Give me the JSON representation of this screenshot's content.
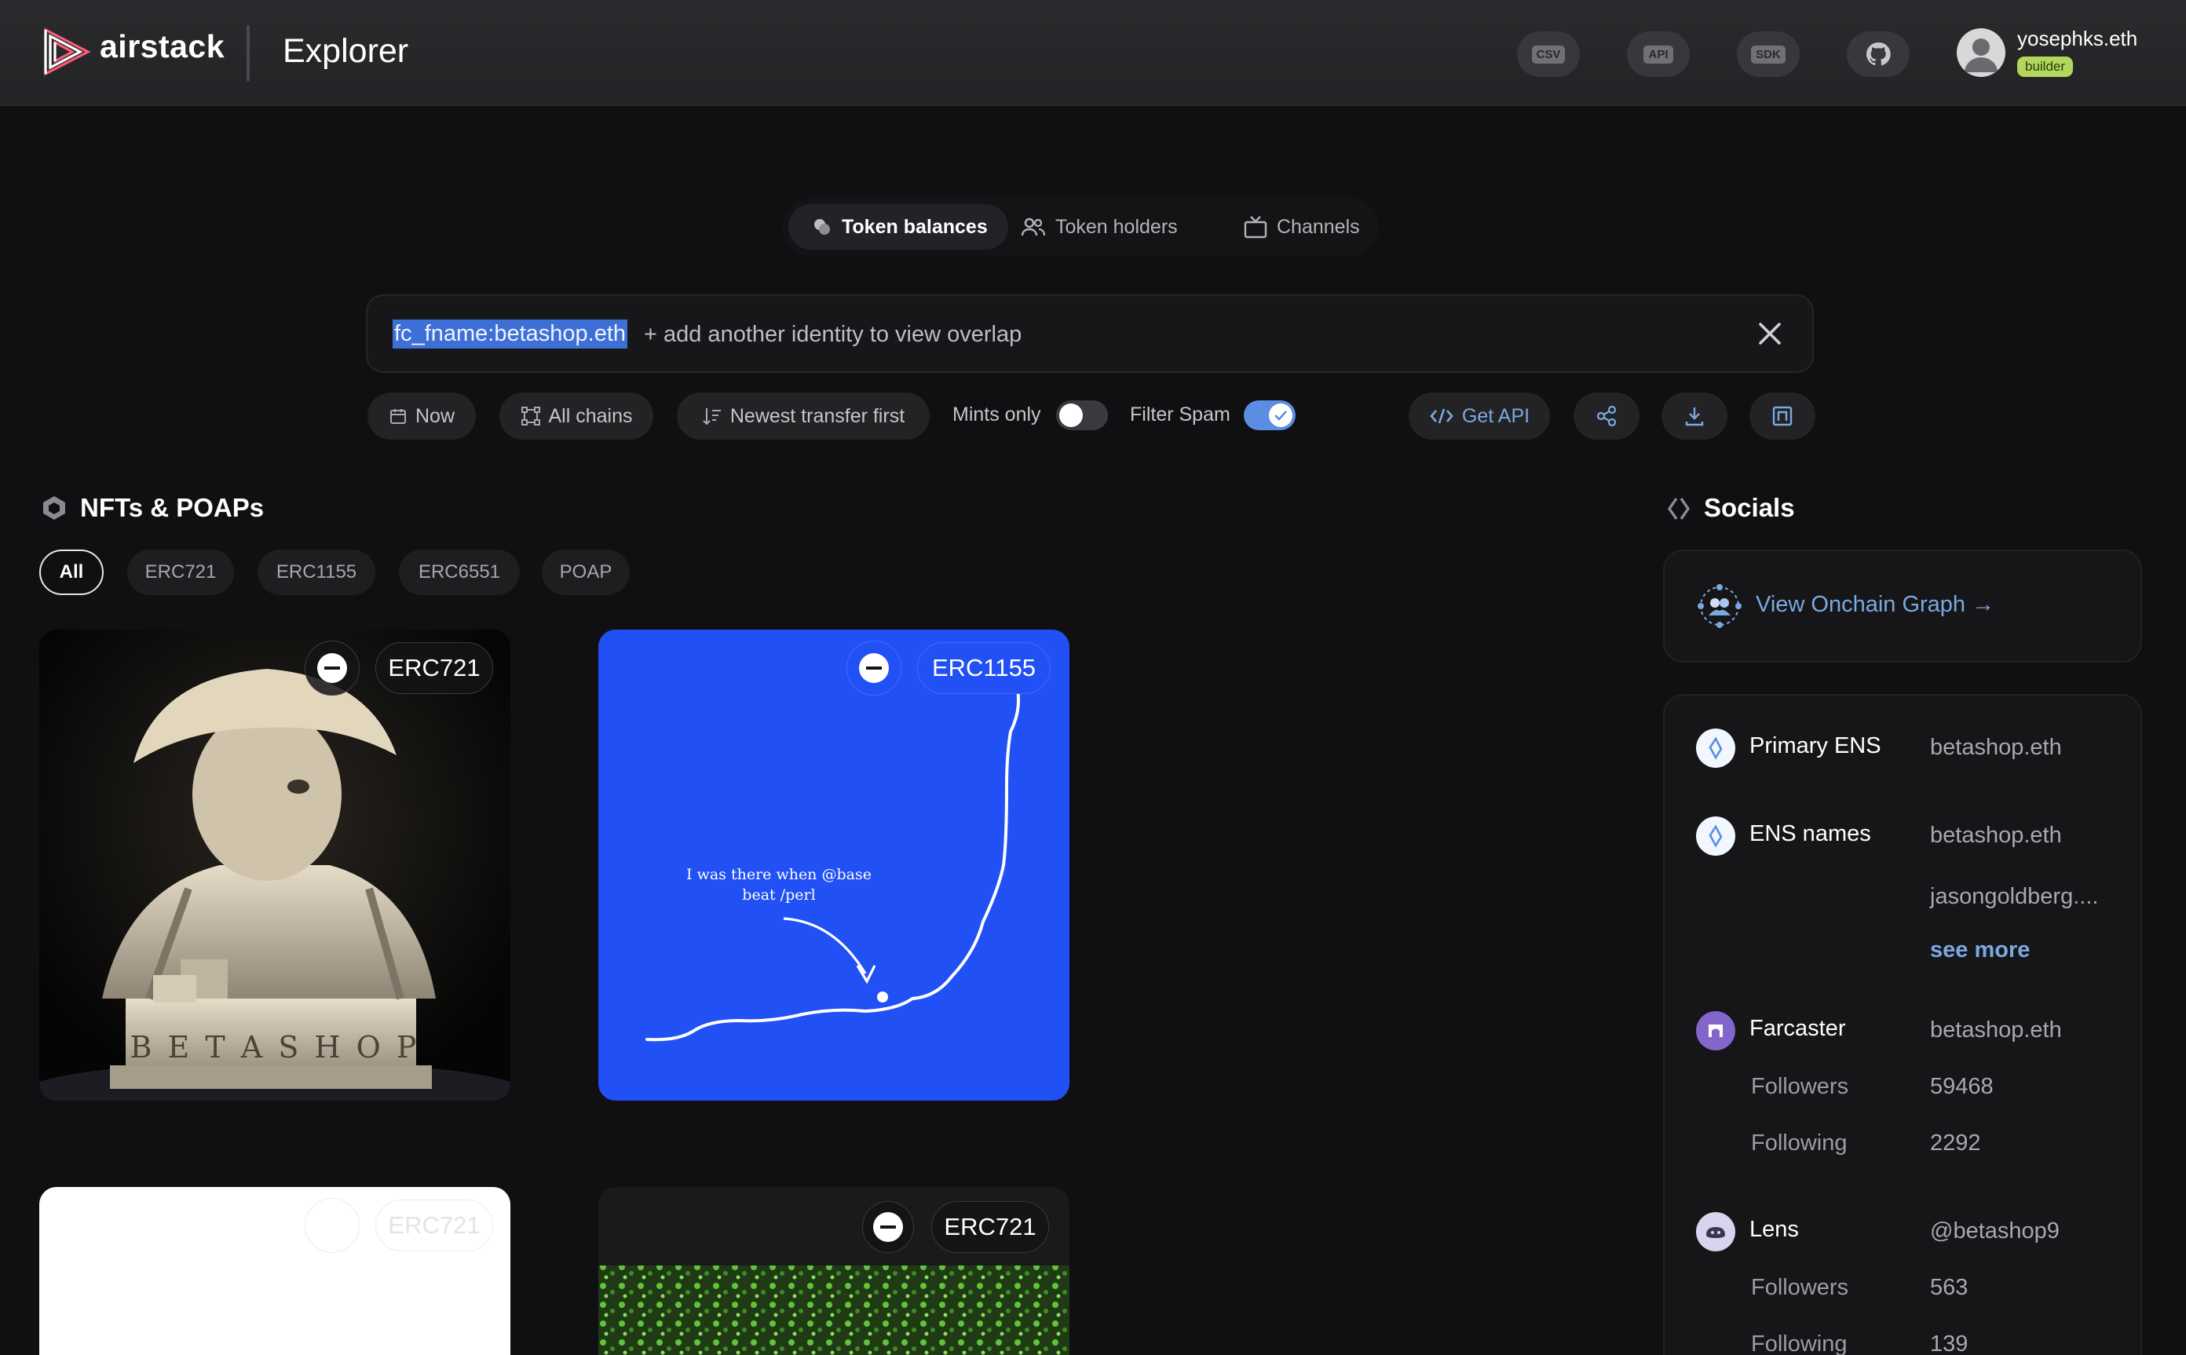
{
  "header": {
    "brand": "airstack",
    "title": "Explorer",
    "buttons": [
      {
        "name": "csv",
        "label": "CSV"
      },
      {
        "name": "api",
        "label": "API"
      },
      {
        "name": "sdk",
        "label": "SDK"
      },
      {
        "name": "github",
        "icon": "github-icon"
      }
    ],
    "user": {
      "name": "yosephks.eth",
      "badge": "builder"
    }
  },
  "tabs": [
    {
      "label": "Token balances",
      "icon": "coins-icon",
      "active": true
    },
    {
      "label": "Token holders",
      "icon": "users-icon",
      "active": false
    },
    {
      "label": "Channels",
      "icon": "tv-icon",
      "active": false
    }
  ],
  "search": {
    "identity": "fc_fname:betashop.eth",
    "placeholder": "+ add another identity to view overlap"
  },
  "filters": {
    "time": "Now",
    "chains": "All chains",
    "sort": "Newest transfer first",
    "mints_only": {
      "label": "Mints only",
      "on": false
    },
    "filter_spam": {
      "label": "Filter Spam",
      "on": true
    },
    "get_api": "Get API"
  },
  "nfts": {
    "title": "NFTs & POAPs",
    "chips": [
      "All",
      "ERC721",
      "ERC1155",
      "ERC6551",
      "POAP"
    ],
    "cards": [
      {
        "type": "ERC721",
        "image_text": "BETASHOP"
      },
      {
        "type": "ERC1155",
        "image_text": "I was there when @base beat /perl"
      },
      {
        "type": "ERC721"
      },
      {
        "type": "ERC721"
      }
    ]
  },
  "socials": {
    "title": "Socials",
    "graph_link": "View Onchain Graph →",
    "primary_ens": {
      "label": "Primary ENS",
      "value": "betashop.eth"
    },
    "ens_names": {
      "label": "ENS names",
      "values": [
        "betashop.eth",
        "jasongoldberg...."
      ],
      "see_more": "see more"
    },
    "farcaster": {
      "label": "Farcaster",
      "value": "betashop.eth",
      "followers_label": "Followers",
      "followers": "59468",
      "following_label": "Following",
      "following": "2292"
    },
    "lens": {
      "label": "Lens",
      "value": "@betashop9",
      "followers_label": "Followers",
      "followers": "563",
      "following_label": "Following",
      "following": "139"
    }
  },
  "colors": {
    "accent": "#3d6fd6",
    "toggle_on": "#5b8ee0",
    "erc1155_bg": "#2150f5",
    "builder_badge": "#b3d65c",
    "link": "#7aa9e0"
  }
}
